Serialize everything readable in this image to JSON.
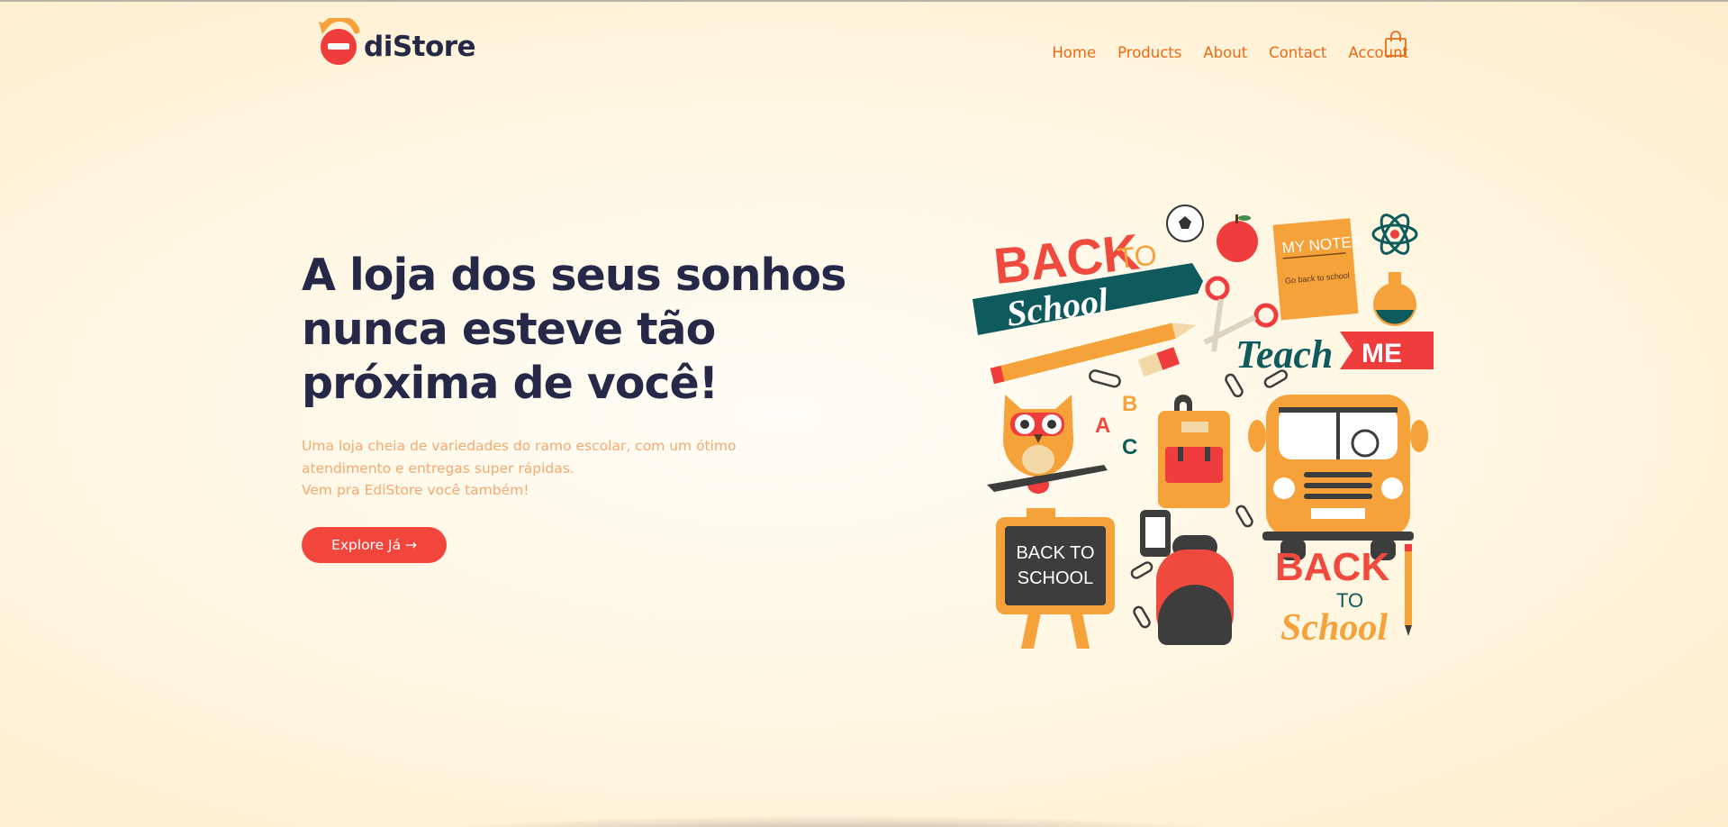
{
  "brand": {
    "name": "diStore",
    "mark_letter": "e",
    "colors": {
      "accent": "#f2463c",
      "nav": "#ec6a16",
      "dark": "#252847",
      "muted": "#f4a96f"
    }
  },
  "nav": {
    "items": [
      "Home",
      "Products",
      "About",
      "Contact",
      "Account"
    ],
    "cart_icon": "shopping-bag-icon"
  },
  "hero": {
    "title": "A loja dos seus sonhos nunca esteve tão próxima de você!",
    "description_line1": "Uma loja cheia de variedades do ramo escolar, com um ótimo atendimento e entregas super rápidas.",
    "description_line2": "Vem pra EdiStore você também!",
    "cta": "Explore Já →"
  },
  "illustration": {
    "back": "BACK",
    "to": "TO",
    "school": "School",
    "notes_title": "MY NOTES",
    "notes_text": "Go back to school",
    "teach": "Teach",
    "me": "ME",
    "abc": [
      "A",
      "B",
      "C"
    ],
    "board_line1": "BACK TO",
    "board_line2": "SCHOOL"
  }
}
